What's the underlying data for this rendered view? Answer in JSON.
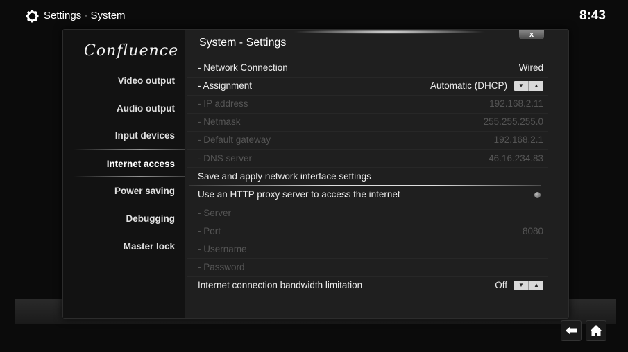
{
  "header": {
    "title": "Settings",
    "separator": " - ",
    "subtitle": "System",
    "clock": "8:43"
  },
  "sidebar": {
    "logo": "Confluence",
    "items": [
      {
        "label": "Video output"
      },
      {
        "label": "Audio output"
      },
      {
        "label": "Input devices"
      },
      {
        "label": "Internet access",
        "selected": true
      },
      {
        "label": "Power saving"
      },
      {
        "label": "Debugging"
      },
      {
        "label": "Master lock"
      }
    ]
  },
  "dialog": {
    "title": "System - Settings",
    "close_label": "x"
  },
  "settings": [
    {
      "label": "- Network Connection",
      "value": "Wired"
    },
    {
      "label": "- Assignment",
      "value": "Automatic (DHCP)"
    },
    {
      "label": "- IP address",
      "value": "192.168.2.11",
      "disabled": true
    },
    {
      "label": "- Netmask",
      "value": "255.255.255.0",
      "disabled": true
    },
    {
      "label": "- Default gateway",
      "value": "192.168.2.1",
      "disabled": true
    },
    {
      "label": "- DNS server",
      "value": "46.16.234.83",
      "disabled": true
    },
    {
      "label": "Save and apply network interface settings",
      "value": ""
    },
    {
      "label": "Use an HTTP proxy server to access the internet",
      "value": ""
    },
    {
      "label": "- Server",
      "value": "",
      "disabled": true
    },
    {
      "label": "- Port",
      "value": "8080",
      "disabled": true
    },
    {
      "label": "- Username",
      "value": "",
      "disabled": true
    },
    {
      "label": "- Password",
      "value": "",
      "disabled": true
    },
    {
      "label": "Internet connection bandwidth limitation",
      "value": "Off"
    }
  ],
  "icons": {
    "gear": "gear-icon",
    "back": "back-arrow-icon",
    "home": "home-icon"
  }
}
